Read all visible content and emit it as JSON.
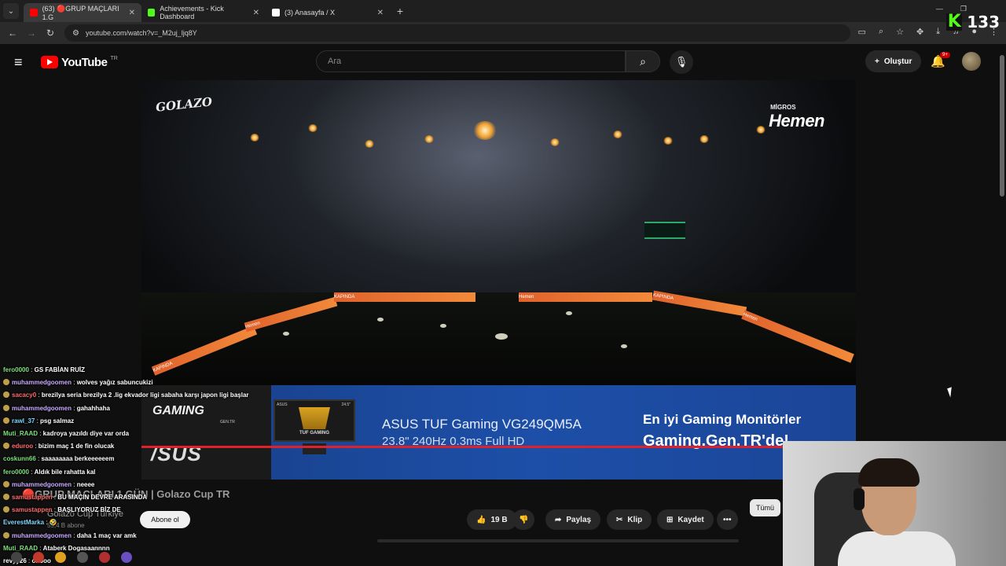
{
  "browser": {
    "tabs": [
      {
        "label": "(63) 🔴GRUP MAÇLARI 1.G",
        "active": true,
        "favicon_color": "#ff0000"
      },
      {
        "label": "Achievements - Kick Dashboard",
        "active": false,
        "favicon_color": "#53fc18"
      },
      {
        "label": "(3) Anasayfa / X",
        "active": false,
        "favicon_color": "#ffffff"
      }
    ],
    "url": "youtube.com/watch?v=_M2uj_ljq8Y",
    "new_tab": "+"
  },
  "kick": {
    "count": "133",
    "logo": "K"
  },
  "youtube": {
    "logo": "YouTube",
    "region": "TR",
    "search_placeholder": "Ara",
    "create_label": "Oluştur",
    "notifications": "9+"
  },
  "video": {
    "watermark": "GOLAZO",
    "sponsor_small": "MİGROS",
    "sponsor_big": "Hemen",
    "boards": [
      "KAPINDA",
      "Hemen",
      "KAPINDA",
      "Hemen",
      "KAPINDA",
      "Hemen",
      "KAPINDA"
    ]
  },
  "ad": {
    "brand_gaming": "GAMING",
    "brand_gaming_sub": "GEN.TR",
    "brand_asus": "/SUS",
    "monitor_brand": "ASUS",
    "monitor_size": "24.5\"",
    "monitor_text": "TUF GAMING",
    "product": "ASUS TUF Gaming VG249QM5A",
    "spec": "23.8\" 240Hz 0.3ms Full HD",
    "tagline1": "En iyi Gaming Monitörler",
    "tagline2": "Gaming.Gen.TR'de!"
  },
  "meta": {
    "title": "🔴GRUP MAÇLARI 1.GÜN | Golazo Cup TR",
    "channel": "Golazo Cup Türkiye",
    "subscribers": "55,4 B abone",
    "subscribe": "Abone ol",
    "likes": "19 B",
    "share": "Paylaş",
    "clip": "Klip",
    "save": "Kaydet",
    "more": "•••",
    "all_chip": "Tümü"
  },
  "chat": [
    {
      "user": "fero0000",
      "msg": "GS FABİAN RUİZ",
      "color": "#7fe17f",
      "icon": false
    },
    {
      "user": "muhammedgoomen",
      "msg": "wolves yağız sabuncukizi",
      "color": "#c9a9ff",
      "icon": true
    },
    {
      "user": "sacacy0",
      "msg": "brezilya seria brezilya 2 .lig ekvador ligi sabaha karşı japon ligi başlar",
      "color": "#ff6a6a",
      "icon": true
    },
    {
      "user": "muhammedgoomen",
      "msg": "gahahhaha",
      "color": "#c9a9ff",
      "icon": true
    },
    {
      "user": "rawl_37",
      "msg": "psg salmaz",
      "color": "#7fd7ff",
      "icon": true
    },
    {
      "user": "Muti_RAAD",
      "msg": "kadroya yazıldı diye var orda",
      "color": "#7fe17f",
      "icon": false
    },
    {
      "user": "eduroo",
      "msg": "bizim maç 1 de fin olucak",
      "color": "#ff6a6a",
      "icon": true
    },
    {
      "user": "coskunn66",
      "msg": "saaaaaaaa berkeeeeeem",
      "color": "#7fe17f",
      "icon": false
    },
    {
      "user": "fero0000",
      "msg": "Aldık bile rahatta kal",
      "color": "#7fe17f",
      "icon": false
    },
    {
      "user": "muhammedgoomen",
      "msg": "neeee",
      "color": "#c9a9ff",
      "icon": true
    },
    {
      "user": "samustappen",
      "msg": "BU MAÇIN DEVRE ARASINDA",
      "color": "#ff6a6a",
      "icon": true
    },
    {
      "user": "samustappen",
      "msg": "BAŞLIYORUZ BİZ DE",
      "color": "#ff6a6a",
      "icon": true
    },
    {
      "user": "EverestMarka",
      "msg": "🤣",
      "color": "#7fd7ff",
      "icon": false
    },
    {
      "user": "muhammedgoomen",
      "msg": "daha 1 maç var amk",
      "color": "#c9a9ff",
      "icon": true
    },
    {
      "user": "Muti_RAAD",
      "msg": "Ataberk Dogasaannnn",
      "color": "#7fe17f",
      "icon": false
    },
    {
      "user": "revyy26",
      "msg": "ohooo",
      "color": "#ffffff",
      "icon": false
    }
  ]
}
